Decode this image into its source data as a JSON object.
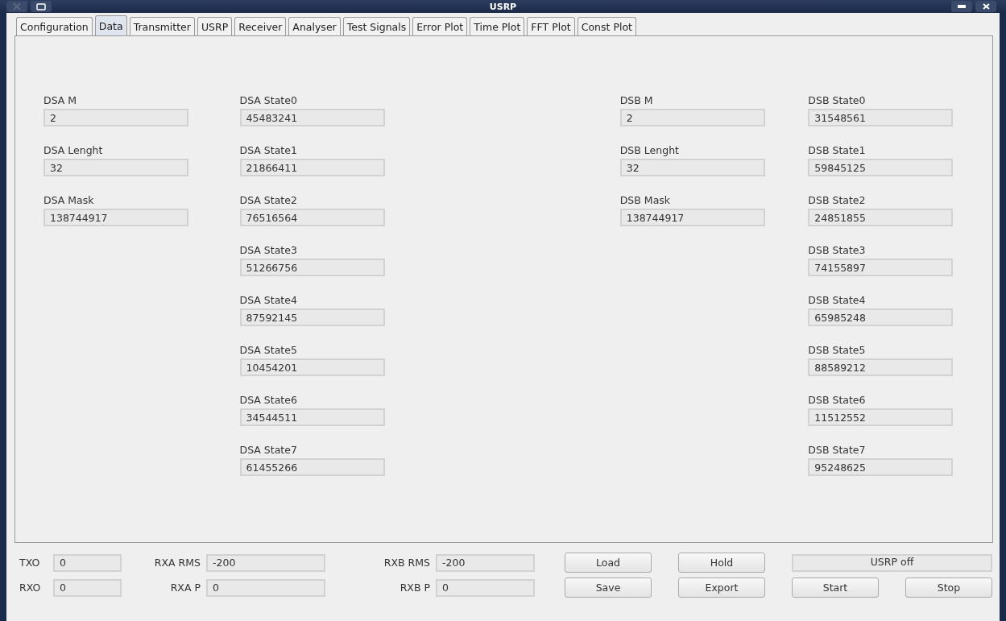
{
  "window": {
    "title": "USRP"
  },
  "tabs": [
    {
      "label": "Configuration",
      "selected": false
    },
    {
      "label": "Data",
      "selected": true
    },
    {
      "label": "Transmitter",
      "selected": false
    },
    {
      "label": "USRP",
      "selected": false
    },
    {
      "label": "Receiver",
      "selected": false
    },
    {
      "label": "Analyser",
      "selected": false
    },
    {
      "label": "Test Signals",
      "selected": false
    },
    {
      "label": "Error Plot",
      "selected": false
    },
    {
      "label": "Time Plot",
      "selected": false
    },
    {
      "label": "FFT Plot",
      "selected": false
    },
    {
      "label": "Const Plot",
      "selected": false
    }
  ],
  "columns": [
    [
      {
        "label": "DSA M",
        "value": "2"
      },
      {
        "label": "DSA Lenght",
        "value": "32"
      },
      {
        "label": "DSA Mask",
        "value": "138744917"
      }
    ],
    [
      {
        "label": "DSA State0",
        "value": "45483241"
      },
      {
        "label": "DSA State1",
        "value": "21866411"
      },
      {
        "label": "DSA State2",
        "value": "76516564"
      },
      {
        "label": "DSA State3",
        "value": "51266756"
      },
      {
        "label": "DSA State4",
        "value": "87592145"
      },
      {
        "label": "DSA State5",
        "value": "10454201"
      },
      {
        "label": "DSA State6",
        "value": "34544511"
      },
      {
        "label": "DSA State7",
        "value": "61455266"
      }
    ],
    [
      {
        "label": "DSB M",
        "value": "2"
      },
      {
        "label": "DSB Lenght",
        "value": "32"
      },
      {
        "label": "DSB Mask",
        "value": "138744917"
      }
    ],
    [
      {
        "label": "DSB State0",
        "value": "31548561"
      },
      {
        "label": "DSB State1",
        "value": "59845125"
      },
      {
        "label": "DSB State2",
        "value": "24851855"
      },
      {
        "label": "DSB State3",
        "value": "74155897"
      },
      {
        "label": "DSB State4",
        "value": "65985248"
      },
      {
        "label": "DSB State5",
        "value": "88589212"
      },
      {
        "label": "DSB State6",
        "value": "11512552"
      },
      {
        "label": "DSB State7",
        "value": "95248625"
      }
    ]
  ],
  "readouts": [
    [
      {
        "label": "TXO",
        "value": "0"
      },
      {
        "label": "RXA RMS",
        "value": "-200"
      },
      {
        "label": "RXB RMS",
        "value": "-200"
      }
    ],
    [
      {
        "label": "RXO",
        "value": "0"
      },
      {
        "label": "RXA P",
        "value": "0"
      },
      {
        "label": "RXB P",
        "value": "0"
      }
    ]
  ],
  "buttons": [
    [
      "Load",
      "Hold"
    ],
    [
      "Save",
      "Export",
      "Start",
      "Stop"
    ]
  ],
  "status": "USRP off"
}
